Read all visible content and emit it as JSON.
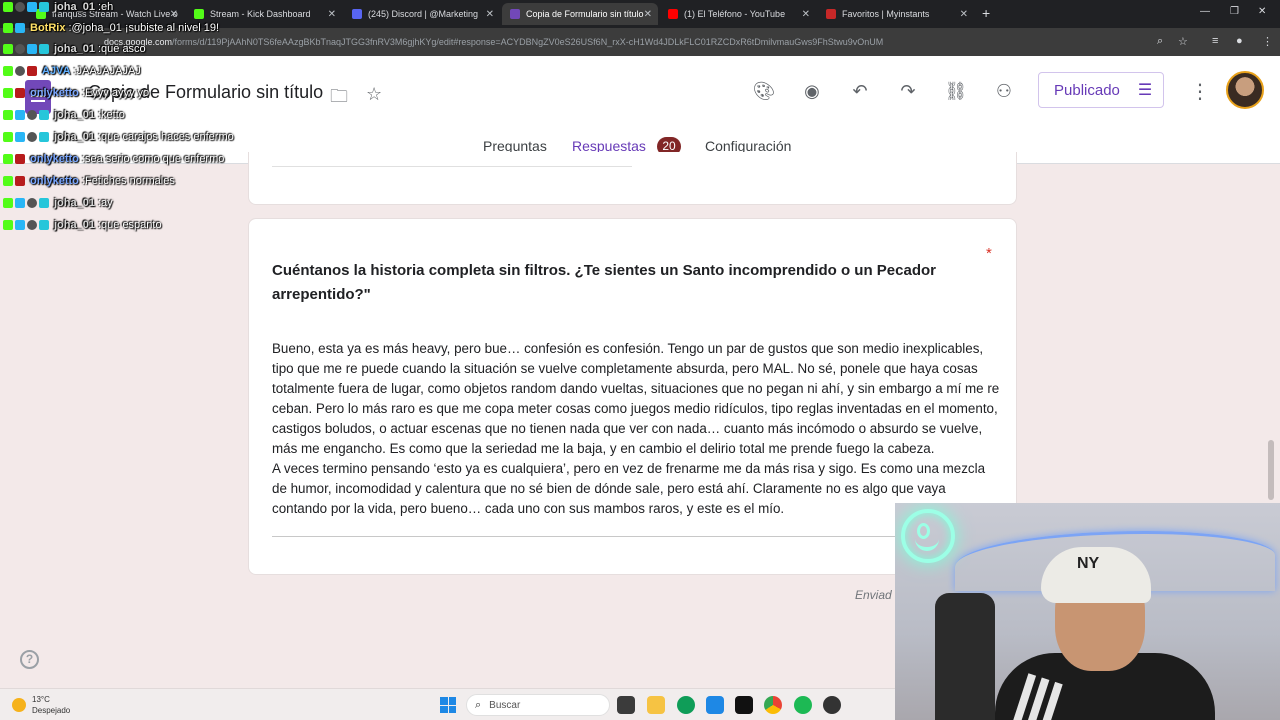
{
  "browser": {
    "tabs": [
      {
        "label": "franquss Stream - Watch Live o",
        "color": "#53fc18"
      },
      {
        "label": "Stream - Kick Dashboard",
        "color": "#53fc18"
      },
      {
        "label": "(245) Discord | @Marketing",
        "color": "#5865f2"
      },
      {
        "label": "Copia de Formulario sin título",
        "color": "#7248b9"
      },
      {
        "label": "(1) El Teléfono - YouTube",
        "color": "#ff0000"
      },
      {
        "label": "Favoritos | Myinstants",
        "color": "#c62828"
      }
    ],
    "url_host": "docs.google.com",
    "url_path": "/forms/d/119PjAAhN0TS6feAAzgBKbTnaqJTGG3fnRV3M6gjhKYg/edit#response=ACYDBNgZV0eS26USf6N_rxX-cH1Wd4JDLkFLC01RZCDxR6tDmilvmauGws9FhStwu9vOnUM"
  },
  "header": {
    "title": "Copia de Formulario sin título",
    "publish_label": "Publicado",
    "tabs": [
      {
        "label": "Preguntas"
      },
      {
        "label": "Respuestas",
        "count": "20"
      },
      {
        "label": "Configuración"
      }
    ]
  },
  "question": {
    "title": "Cuéntanos la historia completa sin filtros. ¿Te sientes un Santo incomprendido o un Pecador arrepentido?\"",
    "required_mark": "*",
    "answer_p1": "Bueno, esta ya es más heavy, pero bue… confesión es confesión. Tengo un par de gustos que son medio inexplicables, tipo que me re puede cuando la situación se vuelve completamente absurda, pero MAL. No sé, ponele que haya cosas totalmente fuera de lugar, como objetos random dando vueltas, situaciones que no pegan ni ahí, y sin embargo a mí me re ceban. Pero lo más raro es que me copa meter cosas como juegos medio ridículos, tipo reglas inventadas en el momento, castigos boludos, o actuar escenas que no tienen nada que ver con nada… cuanto más incómodo o absurdo se vuelve, más me engancho. Es como que la seriedad me la baja, y en cambio el delirio total me prende fuego la cabeza.",
    "answer_p2": "A veces termino pensando ‘esto ya es cualquiera’, pero en vez de frenarme me da más risa y sigo. Es como una mezcla de humor, incomodidad y calentura que no sé bien de dónde sale, pero está ahí. Claramente no es algo que vaya contando por la vida, pero bueno… cada uno con sus mambos raros, y este es el mío."
  },
  "footer": {
    "sent_label": "Enviad",
    "help": "?"
  },
  "chat": [
    {
      "user": "joha_01",
      "sep": " : ",
      "msg": "eh",
      "style": "johna"
    },
    {
      "user": "BotRix",
      "sep": " : ",
      "msg": "@joha_01 ¡subiste al nivel 19!",
      "style": "botrix"
    },
    {
      "user": "joha_01",
      "sep": " : ",
      "msg": "que asco",
      "style": "johna"
    },
    {
      "user": "AJVA",
      "sep": " : ",
      "msg": "JAAJAJAJAJ",
      "style": "aj"
    },
    {
      "user": "onlyketto",
      "sep": " : ",
      "msg": "Eyyy ayyy yo",
      "style": "only"
    },
    {
      "user": "joha_01",
      "sep": " : ",
      "msg": "ketto",
      "style": "johna"
    },
    {
      "user": "joha_01",
      "sep": " : ",
      "msg": "que carajos haces enfermo",
      "style": "johna"
    },
    {
      "user": "onlyketto",
      "sep": " : ",
      "msg": "sea serio como que enfermo",
      "style": "only"
    },
    {
      "user": "onlyketto",
      "sep": " : ",
      "msg": "Fetiches normales",
      "style": "only"
    },
    {
      "user": "joha_01",
      "sep": " : ",
      "msg": "ay",
      "style": "johna"
    },
    {
      "user": "joha_01",
      "sep": " : ",
      "msg": "que espanto",
      "style": "johna"
    }
  ],
  "webcam": {
    "cap_logo": "NY"
  },
  "taskbar": {
    "temp": "13°C",
    "weather": "Despejado",
    "search_placeholder": "Buscar"
  }
}
